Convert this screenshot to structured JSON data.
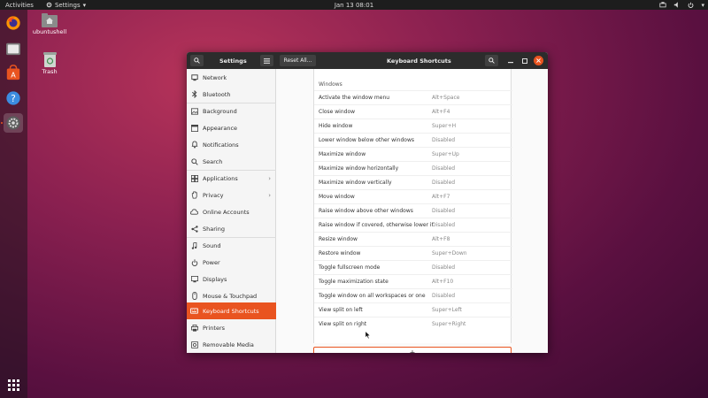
{
  "topbar": {
    "activities": "Activities",
    "app_menu": "Settings",
    "clock": "Jan 13  08:01"
  },
  "desktop": {
    "home_label": "ubuntushell",
    "trash_label": "Trash"
  },
  "window": {
    "sidebar_title": "Settings",
    "reset_label": "Reset All...",
    "panel_title": "Keyboard Shortcuts"
  },
  "sidebar": {
    "items": [
      {
        "label": "Network",
        "icon": "network-icon"
      },
      {
        "label": "Bluetooth",
        "icon": "bluetooth-icon"
      },
      {
        "label": "Background",
        "icon": "background-icon"
      },
      {
        "label": "Appearance",
        "icon": "appearance-icon"
      },
      {
        "label": "Notifications",
        "icon": "bell-icon"
      },
      {
        "label": "Search",
        "icon": "search-icon"
      },
      {
        "label": "Applications",
        "icon": "apps-icon"
      },
      {
        "label": "Privacy",
        "icon": "hand-icon"
      },
      {
        "label": "Online Accounts",
        "icon": "cloud-icon"
      },
      {
        "label": "Sharing",
        "icon": "share-icon"
      },
      {
        "label": "Sound",
        "icon": "music-note-icon"
      },
      {
        "label": "Power",
        "icon": "power-icon"
      },
      {
        "label": "Displays",
        "icon": "display-icon"
      },
      {
        "label": "Mouse & Touchpad",
        "icon": "mouse-icon"
      },
      {
        "label": "Keyboard Shortcuts",
        "icon": "keyboard-icon"
      },
      {
        "label": "Printers",
        "icon": "printer-icon"
      },
      {
        "label": "Removable Media",
        "icon": "media-icon"
      }
    ],
    "selected": "Keyboard Shortcuts"
  },
  "shortcuts": {
    "section": "Windows",
    "rows": [
      {
        "name": "Activate the window menu",
        "accel": "Alt+Space"
      },
      {
        "name": "Close window",
        "accel": "Alt+F4"
      },
      {
        "name": "Hide window",
        "accel": "Super+H"
      },
      {
        "name": "Lower window below other windows",
        "accel": "Disabled"
      },
      {
        "name": "Maximize window",
        "accel": "Super+Up"
      },
      {
        "name": "Maximize window horizontally",
        "accel": "Disabled"
      },
      {
        "name": "Maximize window vertically",
        "accel": "Disabled"
      },
      {
        "name": "Move window",
        "accel": "Alt+F7"
      },
      {
        "name": "Raise window above other windows",
        "accel": "Disabled"
      },
      {
        "name": "Raise window if covered, otherwise lower it",
        "accel": "Disabled"
      },
      {
        "name": "Resize window",
        "accel": "Alt+F8"
      },
      {
        "name": "Restore window",
        "accel": "Super+Down"
      },
      {
        "name": "Toggle fullscreen mode",
        "accel": "Disabled"
      },
      {
        "name": "Toggle maximization state",
        "accel": "Alt+F10"
      },
      {
        "name": "Toggle window on all workspaces or one",
        "accel": "Disabled"
      },
      {
        "name": "View split on left",
        "accel": "Super+Left"
      },
      {
        "name": "View split on right",
        "accel": "Super+Right"
      }
    ],
    "add_label": "+"
  },
  "colors": {
    "accent": "#e95420",
    "titlebar": "#2c2c2c",
    "topbar": "#1d1d1d"
  }
}
